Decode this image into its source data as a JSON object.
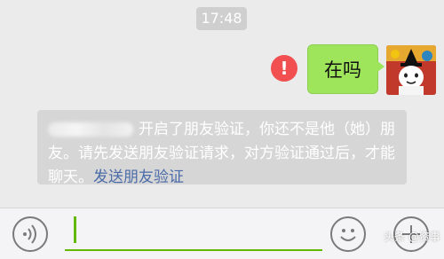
{
  "chat": {
    "timestamp": "17:48",
    "outgoing_message": "在吗",
    "send_failed_icon": "error-icon",
    "error_mark": "!",
    "avatar_icon": "cartoon-avatar"
  },
  "system_notice": {
    "text": "开启了朋友验证，你还不是他（她）朋友。请先发送朋友验证请求，对方验证通过后，才能聊天。",
    "link": "发送朋友验证"
  },
  "input_bar": {
    "voice_icon": "voice-icon",
    "emoji_icon": "emoji-icon",
    "plus_icon": "plus-icon",
    "input_value": ""
  },
  "watermark": "头条 @资事",
  "colors": {
    "bubble_green": "#9ee55b",
    "error_red": "#f25050",
    "link_blue": "#4b6ba8",
    "input_underline": "#62b900"
  }
}
